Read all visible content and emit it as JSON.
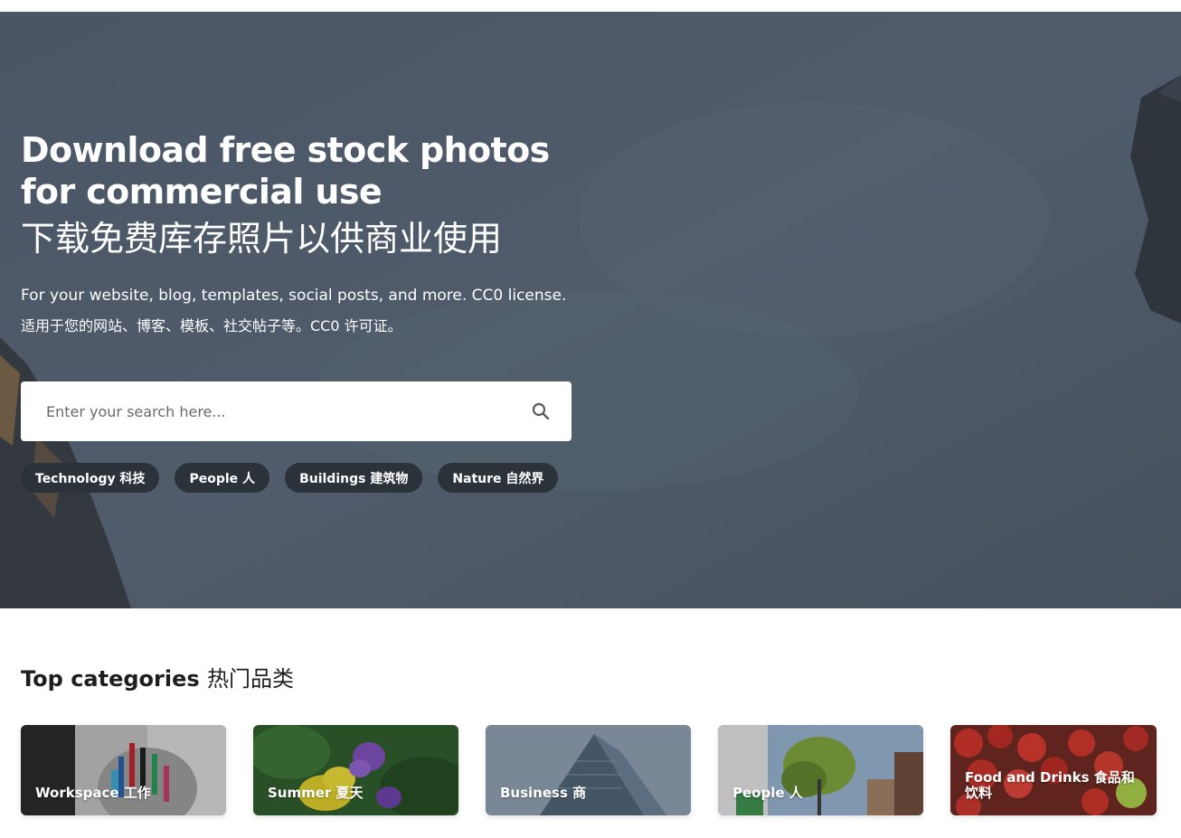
{
  "hero": {
    "title": "Download free stock photos for commercial use",
    "title_cn": "下载免费库存照片以供商业使用",
    "subtitle": "For your website, blog, templates, social posts, and more. CC0 license.",
    "subtitle_cn": "适用于您的网站、博客、模板、社交帖子等。CC0 许可证。",
    "search": {
      "placeholder": "Enter your search here...",
      "icon": "search-icon"
    },
    "tags": [
      {
        "label": "Technology 科技"
      },
      {
        "label": "People 人"
      },
      {
        "label": "Buildings 建筑物"
      },
      {
        "label": "Nature 自然界"
      }
    ]
  },
  "categories": {
    "heading_en": "Top categories",
    "heading_cn": "热门品类",
    "items": [
      {
        "label": "Workspace 工作"
      },
      {
        "label": "Summer 夏天"
      },
      {
        "label": "Business 商"
      },
      {
        "label": "People 人"
      },
      {
        "label": "Food and Drinks 食品和饮料"
      }
    ]
  },
  "colors": {
    "hero_overlay": "#4d5968",
    "tag_bg": "#2b323a",
    "text_dark": "#1e1e1e"
  }
}
